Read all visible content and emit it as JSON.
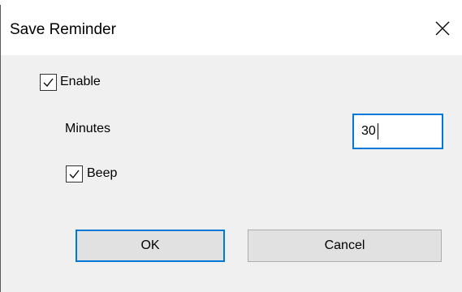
{
  "dialog": {
    "title": "Save Reminder",
    "close_icon": "close-icon"
  },
  "options": {
    "enable": {
      "label": "Enable",
      "checked": true
    },
    "minutes": {
      "label": "Minutes",
      "value": "30"
    },
    "beep": {
      "label": "Beep",
      "checked": true
    }
  },
  "buttons": {
    "ok_label": "OK",
    "cancel_label": "Cancel"
  },
  "colors": {
    "focus_accent": "#0078d7",
    "button_face": "#e1e1e1",
    "dialog_background": "#f0f0f0"
  }
}
